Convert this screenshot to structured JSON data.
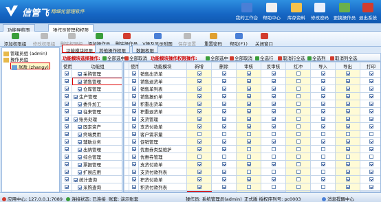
{
  "app": {
    "brand": "信管飞",
    "slogan": "精细化管理软件"
  },
  "top_buttons": [
    {
      "label": "我的工作台",
      "icon": "monitor-icon",
      "color": "#4a7fd6"
    },
    {
      "label": "帮助中心",
      "icon": "help-icon",
      "color": "#f0f0f0"
    },
    {
      "label": "库存资料",
      "icon": "stock-icon",
      "color": "#f5c24b"
    },
    {
      "label": "修改密码",
      "icon": "key-icon",
      "color": "#e9f0fb"
    },
    {
      "label": "更换操作员",
      "icon": "users-icon",
      "color": "#6ab04c"
    },
    {
      "label": "退出系统",
      "icon": "power-icon",
      "color": "#d23c2e"
    }
  ],
  "window_tabs": [
    "功能导航面",
    "操作员管理和权限"
  ],
  "toolbar": [
    {
      "label": "添加权限组",
      "icon": "add-group-icon",
      "color": "#3a9e3a",
      "enabled": true
    },
    {
      "label": "修改权限组",
      "icon": "edit-group-icon",
      "color": "#bbbbbb",
      "enabled": false
    },
    {
      "label": "删除权限组",
      "icon": "delete-group-icon",
      "color": "#bbbbbb",
      "enabled": false
    },
    {
      "label": "添加操作员",
      "icon": "add-user-icon",
      "color": "#3a9e3a",
      "enabled": true
    },
    {
      "label": "删除操作员",
      "icon": "delete-user-icon",
      "color": "#d23c2e",
      "enabled": true
    },
    {
      "label": "V操及显示附图",
      "icon": "view-icon",
      "color": "#4a7fd6",
      "enabled": true
    },
    {
      "label": "保存设置",
      "icon": "save-icon",
      "color": "#bbbbbb",
      "enabled": false
    },
    {
      "label": "重置密码",
      "icon": "reset-password-icon",
      "color": "#e0a030",
      "enabled": true
    },
    {
      "label": "帮助(F1)",
      "icon": "help-icon",
      "color": "#4a7fd6",
      "enabled": true
    },
    {
      "label": "关闭窗口",
      "icon": "close-window-icon",
      "color": "#d23c2e",
      "enabled": true
    }
  ],
  "tree": [
    {
      "label": "管理员组 (admin)",
      "level": 0
    },
    {
      "label": "操作员组",
      "level": 0
    },
    {
      "label": "张盈 (zhangy)",
      "level": 1,
      "selected": true
    }
  ],
  "work_tabs": [
    "功能模块权限",
    "其他操作权限",
    "数据权限"
  ],
  "action_bar": {
    "left_label": "功能模块选择操作:",
    "left_all": "全部选中",
    "left_cancel": "全部取消",
    "right_label": "功能模块操作权限操作:",
    "right_items": [
      "全部选中",
      "全部取消",
      "全选行",
      "取消行全选",
      "全选列",
      "取消列全选"
    ]
  },
  "left_table": {
    "headers": [
      "使用",
      "功能组"
    ],
    "rows": [
      {
        "use": true,
        "checked": true,
        "name": "采购管理",
        "indent": 1
      },
      {
        "use": true,
        "checked": true,
        "name": "销售管理",
        "indent": 1,
        "highlight": true
      },
      {
        "use": true,
        "checked": true,
        "name": "仓库管理",
        "indent": 1
      },
      {
        "use": true,
        "checked": true,
        "name": "生产管理",
        "indent": 0
      },
      {
        "use": true,
        "checked": true,
        "name": "委外加工",
        "indent": 1
      },
      {
        "use": true,
        "checked": true,
        "name": "往来管理",
        "indent": 1
      },
      {
        "use": true,
        "checked": true,
        "name": "账务处理",
        "indent": 0
      },
      {
        "use": true,
        "checked": true,
        "name": "固定资产",
        "indent": 1
      },
      {
        "use": true,
        "checked": true,
        "name": "终端费用",
        "indent": 1
      },
      {
        "use": true,
        "checked": true,
        "name": "辅助业务",
        "indent": 1
      },
      {
        "use": true,
        "checked": true,
        "name": "出纳管理",
        "indent": 1
      },
      {
        "use": true,
        "checked": true,
        "name": "综合管理",
        "indent": 1
      },
      {
        "use": true,
        "checked": true,
        "name": "票据管理",
        "indent": 1
      },
      {
        "use": true,
        "checked": true,
        "name": "扩展应用",
        "indent": 1
      },
      {
        "use": true,
        "checked": true,
        "name": "统计查询",
        "indent": 0
      },
      {
        "use": true,
        "checked": true,
        "name": "采购查询",
        "indent": 1
      },
      {
        "use": true,
        "checked": true,
        "name": "销售查询",
        "indent": 1
      }
    ]
  },
  "right_table": {
    "headers": [
      "使用",
      "功能模块",
      "新增",
      "删除",
      "审核",
      "反审核",
      "红冲",
      "导入",
      "导出",
      "打印"
    ],
    "rows": [
      {
        "name": "销售出货单",
        "use": true,
        "perms": [
          true,
          true,
          true,
          true,
          false,
          true,
          true,
          true
        ]
      },
      {
        "name": "销售退货单",
        "use": true,
        "perms": [
          true,
          true,
          true,
          true,
          false,
          true,
          true,
          true
        ]
      },
      {
        "name": "销售单列表",
        "use": true,
        "perms": [
          true,
          true,
          true,
          true,
          false,
          true,
          true,
          true
        ]
      },
      {
        "name": "销售报价单",
        "use": true,
        "perms": [
          true,
          true,
          true,
          true,
          false,
          true,
          true,
          true
        ]
      },
      {
        "name": "积重出货单",
        "use": true,
        "perms": [
          true,
          true,
          true,
          true,
          false,
          true,
          true,
          true
        ]
      },
      {
        "name": "积重退货单",
        "use": true,
        "perms": [
          true,
          true,
          true,
          true,
          false,
          true,
          true,
          true
        ]
      },
      {
        "name": "支货管理",
        "use": true,
        "perms": [
          true,
          true,
          true,
          true,
          false,
          true,
          true,
          true
        ]
      },
      {
        "name": "支货付款单",
        "use": true,
        "perms": [
          true,
          true,
          true,
          true,
          false,
          true,
          true,
          true
        ]
      },
      {
        "name": "客户需求量",
        "use": true,
        "perms": [
          false,
          false,
          false,
          false,
          false,
          false,
          false,
          false
        ]
      },
      {
        "name": "促销管理",
        "use": true,
        "perms": [
          true,
          true,
          true,
          true,
          false,
          true,
          true,
          true
        ]
      },
      {
        "name": "优惠券类型维护",
        "use": true,
        "perms": [
          true,
          true,
          false,
          false,
          false,
          false,
          true,
          true
        ]
      },
      {
        "name": "优惠券管理",
        "use": true,
        "perms": [
          false,
          false,
          false,
          false,
          false,
          false,
          false,
          false
        ]
      },
      {
        "name": "支货付款单",
        "use": true,
        "perms": [
          true,
          true,
          true,
          true,
          false,
          true,
          true,
          true
        ]
      },
      {
        "name": "支货付款列表",
        "use": true,
        "perms": [
          true,
          true,
          false,
          false,
          false,
          false,
          true,
          true
        ]
      },
      {
        "name": "积货付款单",
        "use": true,
        "perms": [
          true,
          true,
          true,
          true,
          false,
          true,
          true,
          true
        ]
      },
      {
        "name": "积货付款列表",
        "use": true,
        "perms": [
          true,
          true,
          false,
          false,
          false,
          false,
          true,
          true
        ]
      },
      {
        "name": "对账单",
        "use": true,
        "perms": [
          true,
          false,
          false,
          false,
          false,
          false,
          false,
          false
        ],
        "current": true
      }
    ]
  },
  "status": [
    {
      "label": "应用中心: 127.0.0.1:7089",
      "icon": "server-icon",
      "color": "#d23c2e"
    },
    {
      "label": "连接状态: 已连接",
      "icon": "connected-icon",
      "color": "#3a9e3a"
    },
    {
      "label": "账套: 演示账套",
      "icon": "",
      "color": ""
    },
    {
      "label": "操作员: 系统管理员(admin)",
      "icon": "",
      "color": ""
    },
    {
      "label": "正式版 授权序列号: pc0003",
      "icon": "",
      "color": ""
    },
    {
      "label": "消息提醒中心",
      "icon": "message-icon",
      "color": "#4a7fd6"
    }
  ]
}
